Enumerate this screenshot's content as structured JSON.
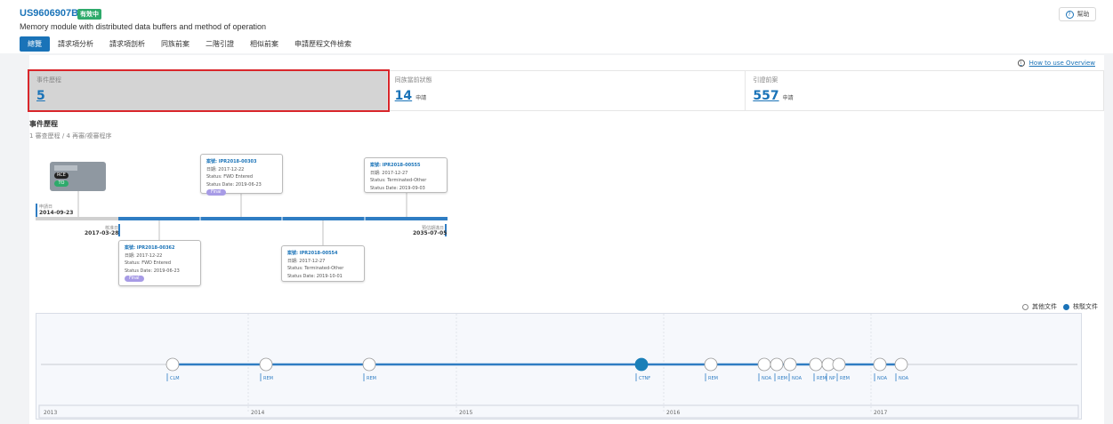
{
  "header": {
    "patent_no": "US9606907B2",
    "status_badge": "有效中",
    "title": "Memory module with distributed data buffers and method of operation",
    "help_label": "幫助"
  },
  "tabs": [
    {
      "label": "總覽"
    },
    {
      "label": "請求項分析"
    },
    {
      "label": "請求項剖析"
    },
    {
      "label": "同族前案"
    },
    {
      "label": "二階引證"
    },
    {
      "label": "相似前案"
    },
    {
      "label": "申請歷程文件檢索"
    }
  ],
  "how_to": "How to use Overview",
  "stats": [
    {
      "label": "事件歷程",
      "value": "5",
      "unit": ""
    },
    {
      "label": "同族當前狀態",
      "value": "14",
      "unit": "申請"
    },
    {
      "label": "引證前案",
      "value": "557",
      "unit": "申請"
    }
  ],
  "events": {
    "title": "事件歷程",
    "subtitle": "1 審查歷程 / 4 再審/複審程序",
    "grey_card": {
      "pill1": "RCE",
      "pill2": "TO"
    },
    "start": {
      "label": "申請日",
      "date": "2014-09-23"
    },
    "grant": {
      "label": "核准日",
      "date": "2017-03-28"
    },
    "expiry": {
      "label": "預估期滿日",
      "date": "2035-07-05"
    },
    "boxes": [
      {
        "case": "案號: IPR2018-00303",
        "filed": "日期: 2017-12-22",
        "status": "Status: FWD Entered",
        "status_date": "Status Date: 2019-06-23",
        "tag": "Final"
      },
      {
        "case": "案號: IPR2018-00555",
        "filed": "日期: 2017-12-27",
        "status": "Status: Terminated-Other",
        "status_date": "Status Date: 2019-09-03",
        "tag": ""
      },
      {
        "case": "案號: IPR2018-00362",
        "filed": "日期: 2017-12-22",
        "status": "Status: FWD Entered",
        "status_date": "Status Date: 2019-06-23",
        "tag": "Final"
      },
      {
        "case": "案號: IPR2018-00554",
        "filed": "日期: 2017-12-27",
        "status": "Status: Terminated-Other",
        "status_date": "Status Date: 2019-10-01",
        "tag": ""
      }
    ]
  },
  "doc_filter": {
    "option1": "其他文件",
    "option2": "核駁文件"
  },
  "doc_timeline": {
    "years": [
      "2013",
      "2014",
      "2015",
      "2016",
      "2017"
    ],
    "markers": [
      "CLM",
      "REM",
      "REM",
      "CTNF",
      "REM",
      "NOA",
      "REM",
      "NOA",
      "REM",
      "NP",
      "REM",
      "NOA",
      "NOA"
    ],
    "colors": {
      "line": "#2f7dc3",
      "filled": "#1a7fb8",
      "axis": "#c8ccd2"
    }
  }
}
